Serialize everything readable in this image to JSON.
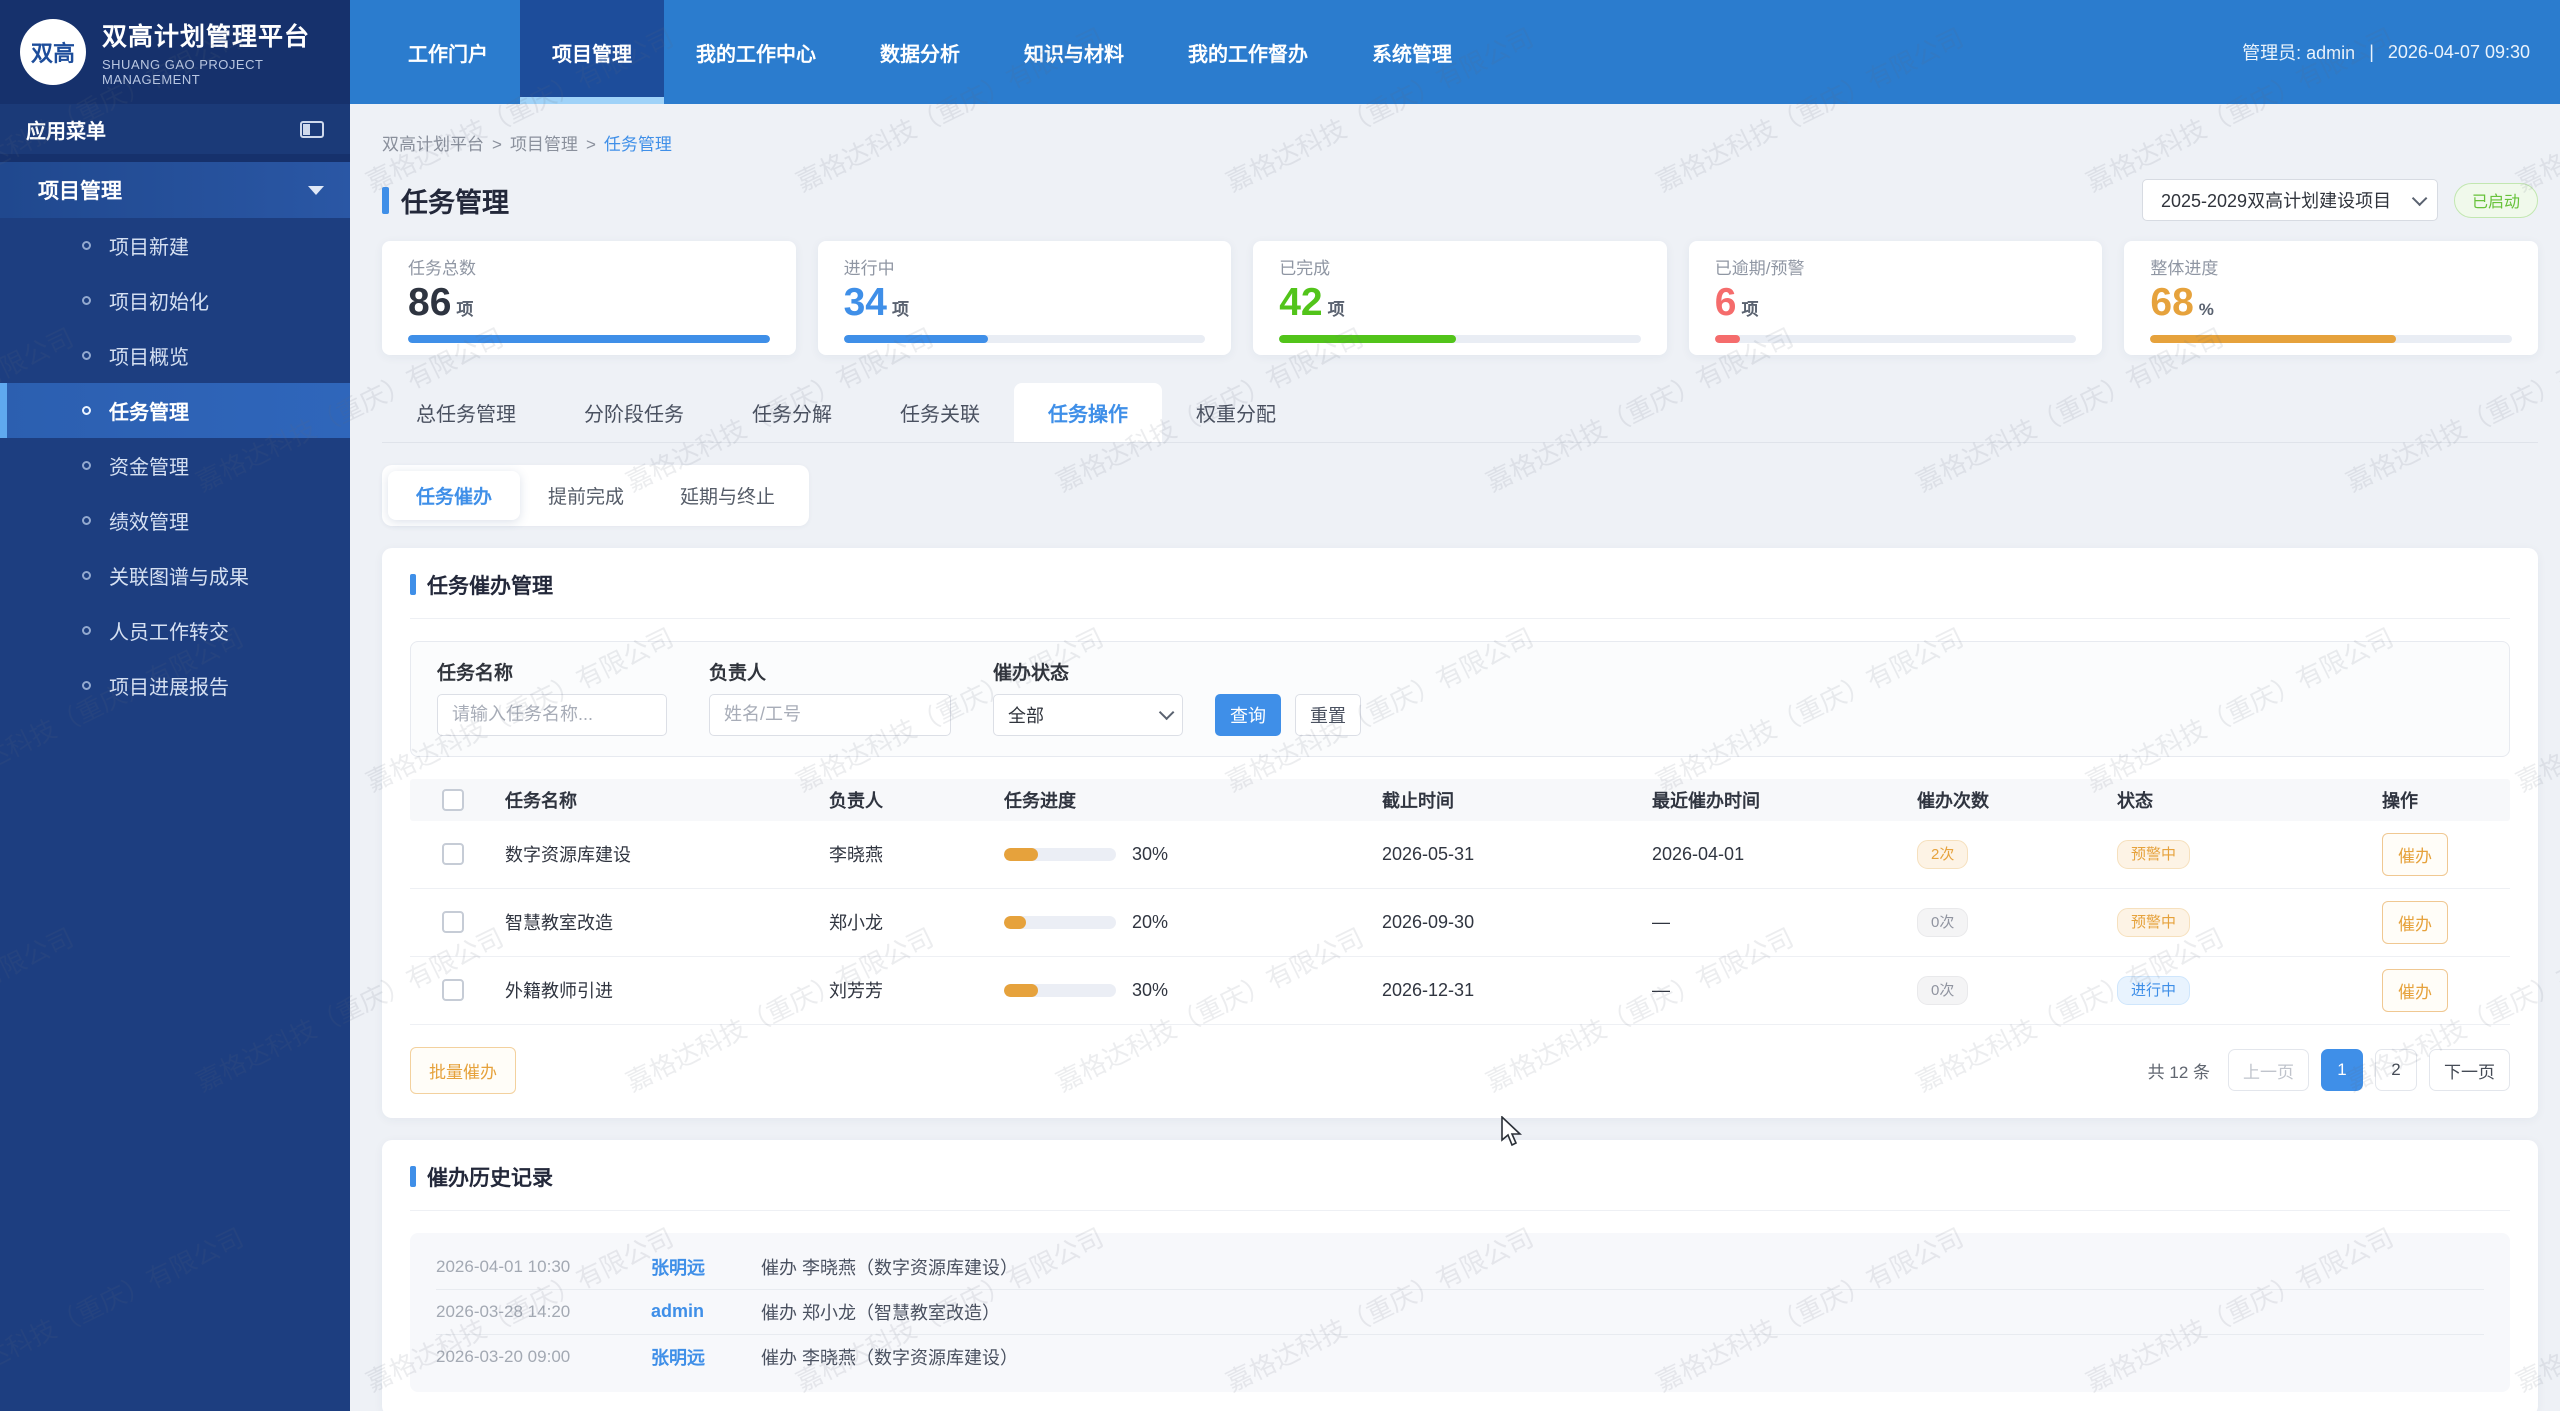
{
  "app": {
    "logo_text": "双高",
    "title": "双高计划管理平台",
    "subtitle": "SHUANG GAO PROJECT MANAGEMENT"
  },
  "topnav": {
    "items": [
      {
        "label": "工作门户",
        "active": false
      },
      {
        "label": "项目管理",
        "active": true
      },
      {
        "label": "我的工作中心",
        "active": false
      },
      {
        "label": "数据分析",
        "active": false
      },
      {
        "label": "知识与材料",
        "active": false
      },
      {
        "label": "我的工作督办",
        "active": false
      },
      {
        "label": "系统管理",
        "active": false
      }
    ],
    "user_label": "管理员: admin",
    "separator": "|",
    "datetime": "2026-04-07 09:30"
  },
  "sidebar": {
    "menu_title": "应用菜单",
    "group_label": "项目管理",
    "items": [
      {
        "label": "项目新建",
        "active": false
      },
      {
        "label": "项目初始化",
        "active": false
      },
      {
        "label": "项目概览",
        "active": false
      },
      {
        "label": "任务管理",
        "active": true
      },
      {
        "label": "资金管理",
        "active": false
      },
      {
        "label": "绩效管理",
        "active": false
      },
      {
        "label": "关联图谱与成果",
        "active": false
      },
      {
        "label": "人员工作转交",
        "active": false
      },
      {
        "label": "项目进展报告",
        "active": false
      }
    ]
  },
  "breadcrumb": {
    "parts": [
      "双高计划平台",
      "项目管理"
    ],
    "current": "任务管理",
    "separator": ">"
  },
  "page_header": {
    "title": "任务管理",
    "project_select_value": "2025-2029双高计划建设项目",
    "status_badge": "已启动",
    "status_color": "#67c23a"
  },
  "stats": [
    {
      "label": "任务总数",
      "value": "86",
      "unit": "项",
      "value_color": "#2e3440",
      "bar_color": "#3f8fe8",
      "bar_pct": 100
    },
    {
      "label": "进行中",
      "value": "34",
      "unit": "项",
      "value_color": "#3f8fe8",
      "bar_color": "#3f8fe8",
      "bar_pct": 40
    },
    {
      "label": "已完成",
      "value": "42",
      "unit": "项",
      "value_color": "#52c41a",
      "bar_color": "#52c41a",
      "bar_pct": 49
    },
    {
      "label": "已逾期/预警",
      "value": "6",
      "unit": "项",
      "value_color": "#f56c6c",
      "bar_color": "#f56c6c",
      "bar_pct": 7
    },
    {
      "label": "整体进度",
      "value": "68",
      "unit": "%",
      "value_color": "#e6a23c",
      "bar_color": "#e6a23c",
      "bar_pct": 68
    }
  ],
  "tabs": [
    {
      "label": "总任务管理",
      "active": false
    },
    {
      "label": "分阶段任务",
      "active": false
    },
    {
      "label": "任务分解",
      "active": false
    },
    {
      "label": "任务关联",
      "active": false
    },
    {
      "label": "任务操作",
      "active": true
    },
    {
      "label": "权重分配",
      "active": false
    }
  ],
  "subtabs": [
    {
      "label": "任务催办",
      "active": true
    },
    {
      "label": "提前完成",
      "active": false
    },
    {
      "label": "延期与终止",
      "active": false
    }
  ],
  "urge_section": {
    "title": "任务催办管理",
    "filters": {
      "task_name_label": "任务名称",
      "task_name_placeholder": "请输入任务名称...",
      "owner_label": "负责人",
      "owner_placeholder": "姓名/工号",
      "status_label": "催办状态",
      "status_value": "全部",
      "search_button": "查询",
      "reset_button": "重置"
    },
    "table": {
      "headers": [
        "任务名称",
        "负责人",
        "任务进度",
        "截止时间",
        "最近催办时间",
        "催办次数",
        "状态",
        "操作"
      ],
      "rows": [
        {
          "name": "数字资源库建设",
          "owner": "李晓燕",
          "progress_pct": 30,
          "progress_text": "30%",
          "deadline": "2026-05-31",
          "last_urged": "2026-04-01",
          "urge_count": "2次",
          "urge_count_type": "warn",
          "status": "预警中",
          "status_type": "warn",
          "action": "催办"
        },
        {
          "name": "智慧教室改造",
          "owner": "郑小龙",
          "progress_pct": 20,
          "progress_text": "20%",
          "deadline": "2026-09-30",
          "last_urged": "—",
          "urge_count": "0次",
          "urge_count_type": "muted",
          "status": "预警中",
          "status_type": "warn",
          "action": "催办"
        },
        {
          "name": "外籍教师引进",
          "owner": "刘芳芳",
          "progress_pct": 30,
          "progress_text": "30%",
          "deadline": "2026-12-31",
          "last_urged": "—",
          "urge_count": "0次",
          "urge_count_type": "muted",
          "status": "进行中",
          "status_type": "info",
          "action": "催办"
        }
      ]
    },
    "batch_button": "批量催办",
    "pagination": {
      "total_text": "共 12 条",
      "prev_label": "上一页",
      "next_label": "下一页",
      "pages": [
        {
          "label": "1",
          "active": true
        },
        {
          "label": "2",
          "active": false
        }
      ]
    }
  },
  "history_section": {
    "title": "催办历史记录",
    "rows": [
      {
        "time": "2026-04-01 10:30",
        "user": "张明远",
        "action": "催办 李晓燕（数字资源库建设）"
      },
      {
        "time": "2026-03-28 14:20",
        "user": "admin",
        "action": "催办 郑小龙（智慧教室改造）"
      },
      {
        "time": "2026-03-20 09:00",
        "user": "张明远",
        "action": "催办 李晓燕（数字资源库建设）"
      }
    ]
  },
  "watermark": {
    "text": "嘉格达科技（重庆）有限公司"
  }
}
